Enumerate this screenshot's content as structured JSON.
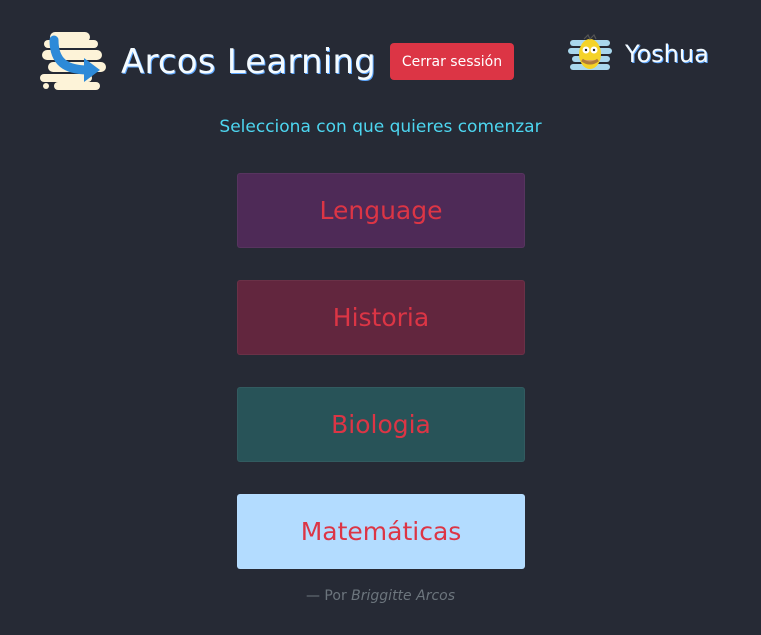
{
  "header": {
    "brand": "Arcos Learning",
    "logout_label": "Cerrar sessión",
    "username": "Yoshua"
  },
  "main": {
    "prompt": "Selecciona con que quieres comenzar",
    "subjects": [
      {
        "label": "Lenguage",
        "color": "#4e2a57"
      },
      {
        "label": "Historia",
        "color": "#62263e"
      },
      {
        "label": "Biologia",
        "color": "#285358"
      },
      {
        "label": "Matemáticas",
        "color": "#b3dcff"
      }
    ]
  },
  "footer": {
    "credit_prefix": "— Por",
    "credit_author": "Briggitte Arcos"
  },
  "colors": {
    "background": "#262a35",
    "accent": "#dc3545",
    "prompt": "#4dd6f0"
  }
}
